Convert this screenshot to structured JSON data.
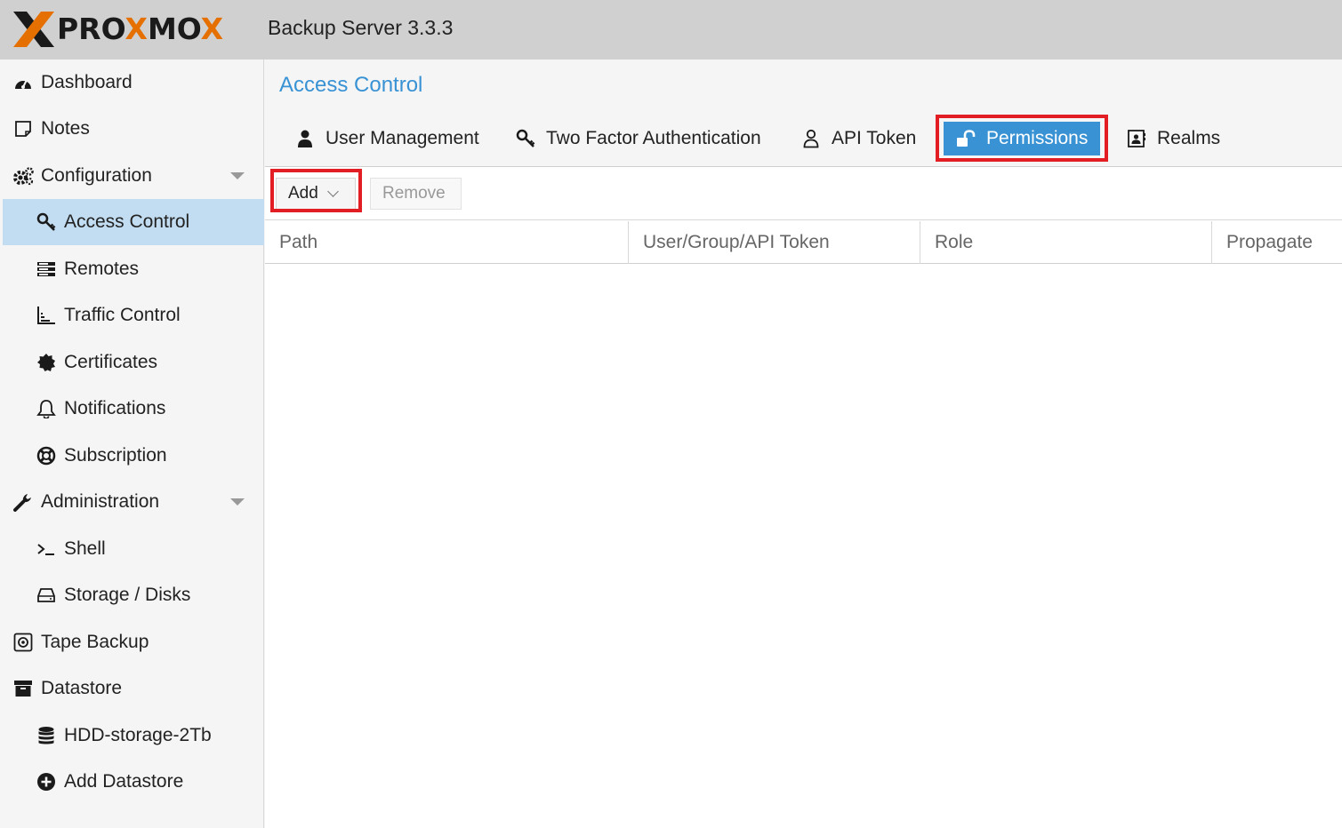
{
  "header": {
    "logo_text_a": "PRO",
    "logo_text_b": "MO",
    "product": "Backup Server 3.3.3"
  },
  "sidebar": {
    "items": [
      {
        "label": "Dashboard",
        "icon": "dashboard-icon"
      },
      {
        "label": "Notes",
        "icon": "notes-icon"
      },
      {
        "label": "Configuration",
        "icon": "gears-icon"
      },
      {
        "label": "Access Control",
        "icon": "key-icon"
      },
      {
        "label": "Remotes",
        "icon": "server-icon"
      },
      {
        "label": "Traffic Control",
        "icon": "bar-chart-icon"
      },
      {
        "label": "Certificates",
        "icon": "certificate-icon"
      },
      {
        "label": "Notifications",
        "icon": "bell-icon"
      },
      {
        "label": "Subscription",
        "icon": "support-icon"
      },
      {
        "label": "Administration",
        "icon": "wrench-icon"
      },
      {
        "label": "Shell",
        "icon": "terminal-icon"
      },
      {
        "label": "Storage / Disks",
        "icon": "hdd-icon"
      },
      {
        "label": "Tape Backup",
        "icon": "tape-icon"
      },
      {
        "label": "Datastore",
        "icon": "archive-icon"
      },
      {
        "label": "HDD-storage-2Tb",
        "icon": "database-icon"
      },
      {
        "label": "Add Datastore",
        "icon": "plus-circle-icon"
      }
    ]
  },
  "main": {
    "title": "Access Control",
    "tabs": [
      {
        "label": "User Management",
        "icon": "user-icon"
      },
      {
        "label": "Two Factor Authentication",
        "icon": "key-icon"
      },
      {
        "label": "API Token",
        "icon": "user-outline-icon"
      },
      {
        "label": "Permissions",
        "icon": "unlock-icon",
        "active": true
      },
      {
        "label": "Realms",
        "icon": "address-book-icon"
      }
    ],
    "toolbar": {
      "add_label": "Add",
      "remove_label": "Remove"
    },
    "columns": [
      "Path",
      "User/Group/API Token",
      "Role",
      "Propagate"
    ]
  },
  "colors": {
    "accent": "#3892d4",
    "active_nav": "#c2ddf2",
    "highlight": "#e21d24",
    "logo_orange": "#e57000"
  }
}
